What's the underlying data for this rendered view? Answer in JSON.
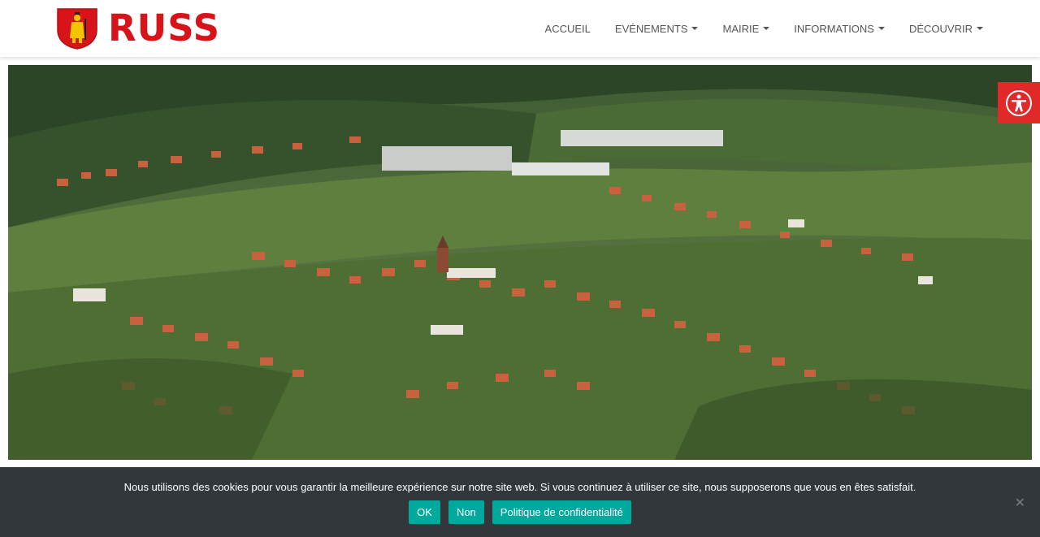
{
  "site": {
    "title": "RUSS"
  },
  "nav": {
    "items": [
      {
        "label": "ACCUEIL",
        "dropdown": false
      },
      {
        "label": "EVÉNEMENTS",
        "dropdown": true
      },
      {
        "label": "MAIRIE",
        "dropdown": true
      },
      {
        "label": "INFORMATIONS",
        "dropdown": true
      },
      {
        "label": "DÉCOUVRIR",
        "dropdown": true
      }
    ]
  },
  "accessibility": {
    "icon": "accessibility-person-icon",
    "color": "#e02a2a"
  },
  "cookie_banner": {
    "message": "Nous utilisons des cookies pour vous garantir la meilleure expérience sur notre site web. Si vous continuez à utiliser ce site, nous supposerons que vous en êtes satisfait.",
    "ok_label": "OK",
    "no_label": "Non",
    "privacy_label": "Politique de confidentialité",
    "close_glyph": "✕",
    "button_color": "#00a99d",
    "background": "#32373c"
  },
  "colors": {
    "brand": "#d7141a"
  }
}
